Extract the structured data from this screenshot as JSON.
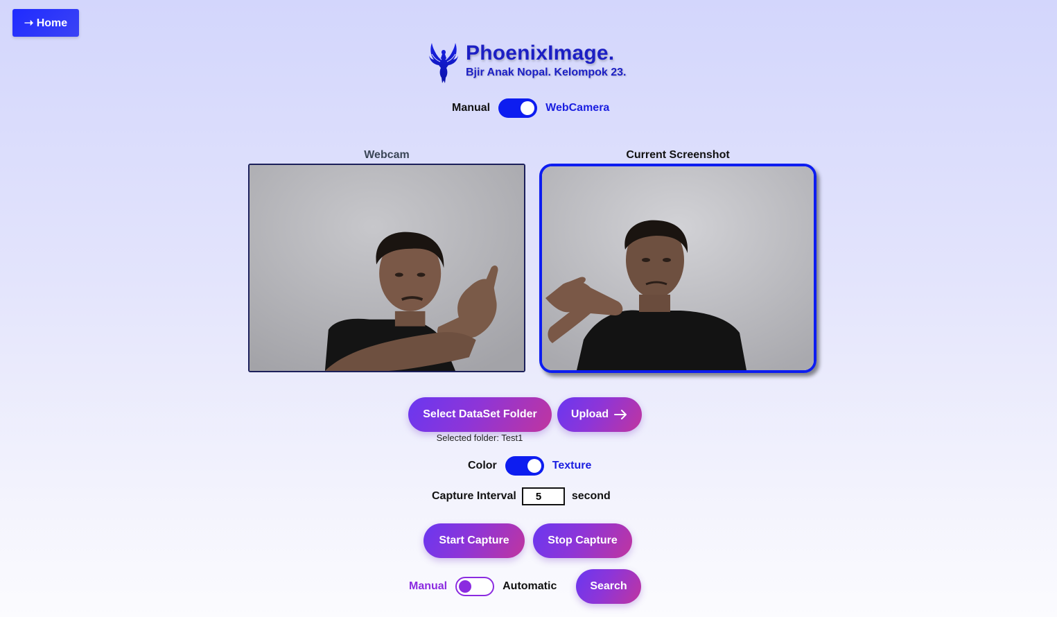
{
  "nav": {
    "home_label": "➝ Home"
  },
  "brand": {
    "title": "PhoenixImage.",
    "subtitle": "Bjir Anak Nopal. Kelompok 23.",
    "logo_icon": "phoenix-logo-icon"
  },
  "mode_toggle": {
    "left_label": "Manual",
    "right_label": "WebCamera",
    "state": "WebCamera"
  },
  "panels": {
    "webcam_label": "Webcam",
    "screenshot_label": "Current Screenshot"
  },
  "dataset": {
    "select_label": "Select DataSet Folder",
    "upload_label": "Upload",
    "selected_folder_text": "Selected folder: Test1"
  },
  "feature_toggle": {
    "left_label": "Color",
    "right_label": "Texture",
    "state": "Texture"
  },
  "capture": {
    "interval_label": "Capture Interval",
    "interval_value": "5",
    "unit_label": "second",
    "start_label": "Start Capture",
    "stop_label": "Stop Capture"
  },
  "search_toggle": {
    "left_label": "Manual",
    "right_label": "Automatic",
    "state": "Manual",
    "search_label": "Search"
  },
  "colors": {
    "accent_blue": "#0d1df0",
    "accent_purple": "#8b2be0",
    "brand_text": "#1c1fc4"
  }
}
